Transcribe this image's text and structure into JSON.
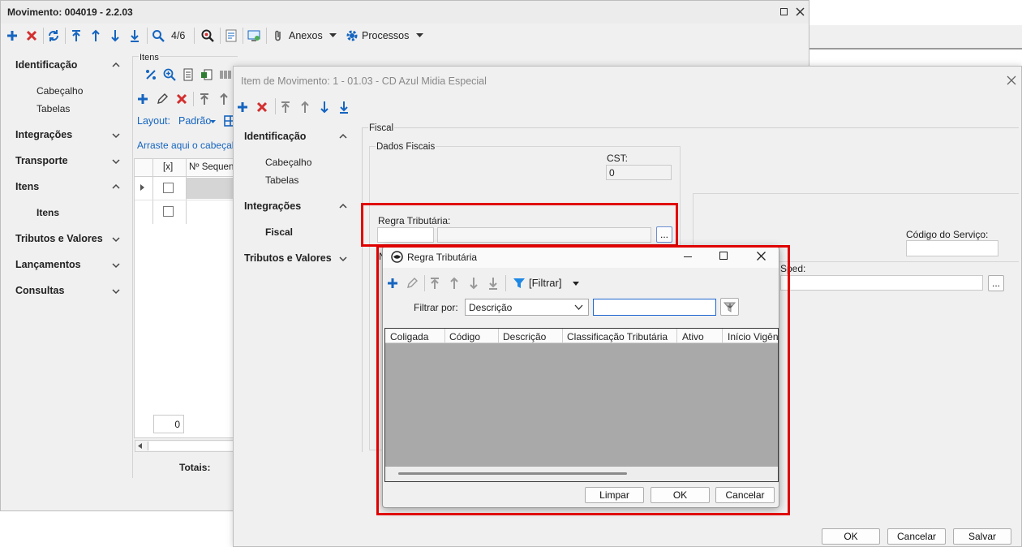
{
  "bg_window": {
    "title": "Movimento: 004019 - 2.2.03",
    "record_counter": "4/6",
    "anexos_label": "Anexos",
    "processos_label": "Processos",
    "nav": [
      {
        "label": "Identificação",
        "expanded": true,
        "children": [
          "Cabeçalho",
          "Tabelas"
        ]
      },
      {
        "label": "Integrações",
        "expanded": false
      },
      {
        "label": "Transporte",
        "expanded": false
      },
      {
        "label": "Itens",
        "expanded": true,
        "children": [
          "Itens"
        ]
      },
      {
        "label": "Tributos e Valores",
        "expanded": false
      },
      {
        "label": "Lançamentos",
        "expanded": false
      },
      {
        "label": "Consultas",
        "expanded": false
      }
    ],
    "itens_group_title": "Itens",
    "layout_label": "Layout:",
    "padrao_label": "Padrão",
    "drag_hint": "Arraste aqui o cabeçalho",
    "grid_columns": [
      "[x]",
      "Nº Sequenc"
    ],
    "pager_value": "0",
    "totais_label": "Totais:"
  },
  "item_window": {
    "title": "Item de Movimento: 1 - 01.03 - CD Azul Midia Especial",
    "nav": [
      {
        "label": "Identificação",
        "children": [
          "Cabeçalho",
          "Tabelas"
        ]
      },
      {
        "label": "Integrações",
        "children": [
          "Fiscal"
        ]
      },
      {
        "label": "Tributos e Valores"
      }
    ],
    "fiscal_group": "Fiscal",
    "dados_fiscais_group": "Dados Fiscais",
    "cst_label": "CST:",
    "cst_value": "0",
    "regra_label": "Regra Tributária:",
    "lookup_button": "...",
    "codigo_servico_label": "Código do Serviço:",
    "sped_label": "Sped:",
    "partial_label": "N",
    "ok_button": "OK",
    "cancelar_button": "Cancelar",
    "salvar_button": "Salvar"
  },
  "lookup_dialog": {
    "title": "Regra Tributária",
    "filter_menu": "[Filtrar]",
    "filter_by_label": "Filtrar por:",
    "filter_field_value": "Descrição",
    "filter_text_value": "",
    "columns": [
      "Coligada",
      "Código",
      "Descrição",
      "Classificação Tributária",
      "Ativo",
      "Início Vigênci"
    ],
    "limpar_button": "Limpar",
    "ok_button": "OK",
    "cancelar_button": "Cancelar"
  },
  "colors": {
    "accent_blue": "#1565c0",
    "delete_red": "#d32f2f",
    "highlight_red": "#e00000",
    "grid_empty": "#a9a9a9"
  }
}
